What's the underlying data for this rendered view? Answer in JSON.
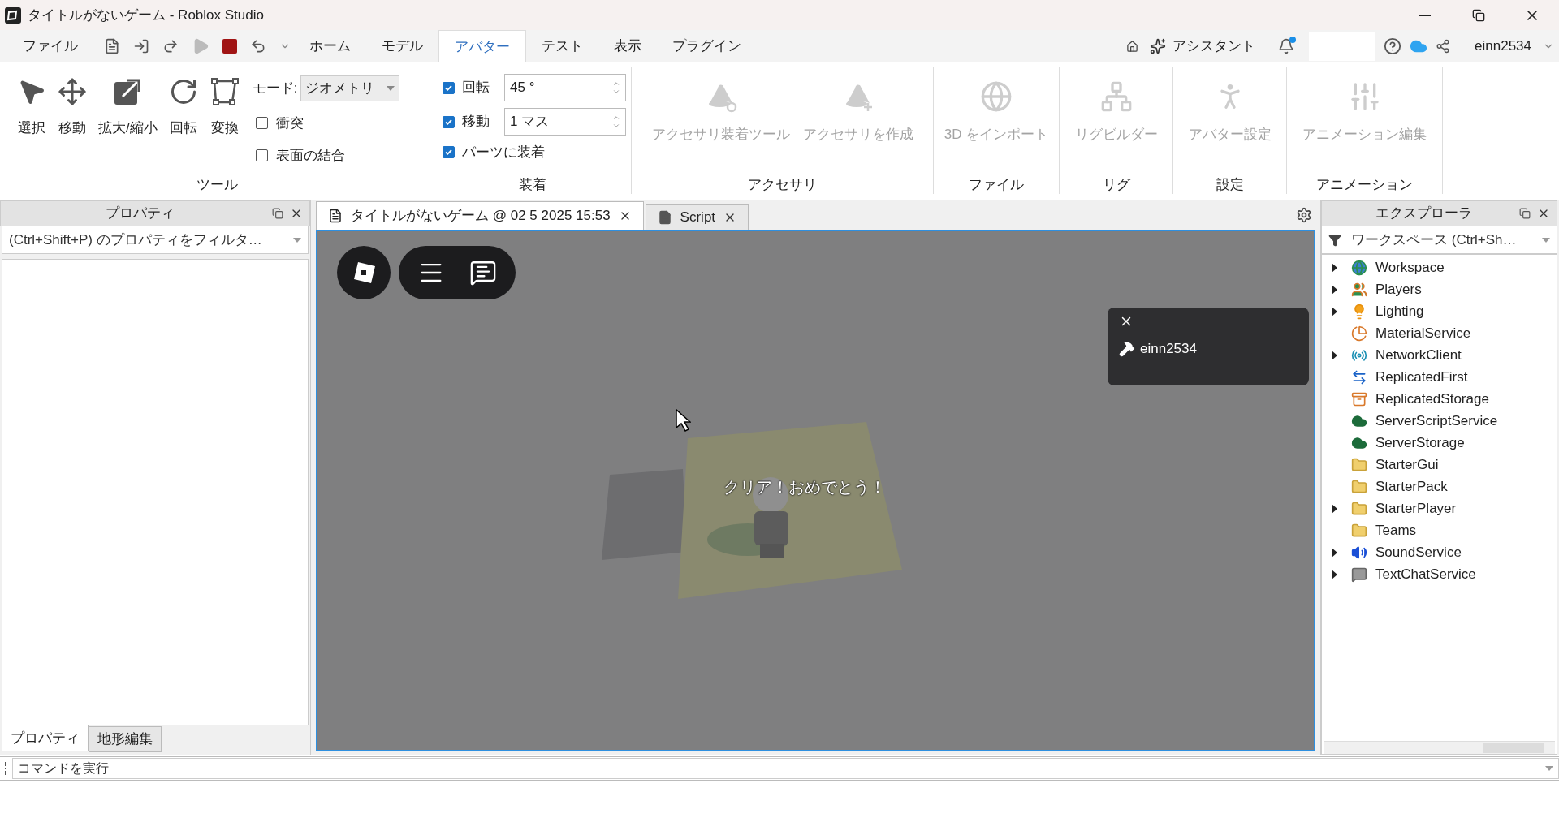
{
  "window": {
    "title": "タイトルがないゲーム - Roblox Studio"
  },
  "menu": {
    "file": "ファイル",
    "tabs": [
      {
        "label": "ホーム",
        "selected": false
      },
      {
        "label": "モデル",
        "selected": false
      },
      {
        "label": "アバター",
        "selected": true
      },
      {
        "label": "テスト",
        "selected": false
      },
      {
        "label": "表示",
        "selected": false
      },
      {
        "label": "プラグイン",
        "selected": false
      }
    ],
    "assistant": "アシスタント",
    "notification_unread": true,
    "user": "einn2534"
  },
  "ribbon": {
    "tools": {
      "label": "ツール",
      "buttons": [
        "選択",
        "移動",
        "拡大/縮小",
        "回転",
        "変換"
      ],
      "mode_label": "モード:",
      "mode_value": "ジオメトリ",
      "options": [
        {
          "label": "衝突",
          "checked": false
        },
        {
          "label": "表面の結合",
          "checked": false
        }
      ]
    },
    "snap": {
      "label": "装着",
      "rows": [
        {
          "label": "回転",
          "checked": true,
          "value": "45 °"
        },
        {
          "label": "移動",
          "checked": true,
          "value": "1 マス"
        }
      ],
      "attach": {
        "label": "パーツに装着",
        "checked": true
      }
    },
    "groups": [
      {
        "label": "アクセサリ",
        "buttons": [
          {
            "label": "アクセサリ装着ツール",
            "disabled": true
          },
          {
            "label": "アクセサリを作成",
            "disabled": true
          }
        ]
      },
      {
        "label": "ファイル",
        "buttons": [
          {
            "label": "3D をインポート",
            "disabled": true
          }
        ]
      },
      {
        "label": "リグ",
        "buttons": [
          {
            "label": "リグビルダー",
            "disabled": true
          }
        ]
      },
      {
        "label": "設定",
        "buttons": [
          {
            "label": "アバター設定",
            "disabled": true
          }
        ]
      },
      {
        "label": "アニメーション",
        "buttons": [
          {
            "label": "アニメーション編集",
            "disabled": true
          }
        ]
      }
    ]
  },
  "properties": {
    "title": "プロパティ",
    "placeholder": "(Ctrl+Shift+P) のプロパティをフィルタ…",
    "tabs": [
      {
        "label": "プロパティ",
        "selected": true
      },
      {
        "label": "地形編集",
        "selected": false
      }
    ]
  },
  "documents": [
    {
      "label": "タイトルがないゲーム @ 02 5 2025 15:53",
      "selected": true
    },
    {
      "label": "Script",
      "selected": false
    }
  ],
  "viewport": {
    "notification_user": "einn2534",
    "message": "クリア！おめでとう！"
  },
  "explorer": {
    "title": "エクスプローラ",
    "placeholder": "ワークスペース (Ctrl+Sh…",
    "items": [
      {
        "name": "Workspace",
        "expandable": true
      },
      {
        "name": "Players",
        "expandable": true
      },
      {
        "name": "Lighting",
        "expandable": true
      },
      {
        "name": "MaterialService",
        "expandable": false
      },
      {
        "name": "NetworkClient",
        "expandable": true
      },
      {
        "name": "ReplicatedFirst",
        "expandable": false
      },
      {
        "name": "ReplicatedStorage",
        "expandable": false
      },
      {
        "name": "ServerScriptService",
        "expandable": false
      },
      {
        "name": "ServerStorage",
        "expandable": false
      },
      {
        "name": "StarterGui",
        "expandable": false
      },
      {
        "name": "StarterPack",
        "expandable": false
      },
      {
        "name": "StarterPlayer",
        "expandable": true
      },
      {
        "name": "Teams",
        "expandable": false
      },
      {
        "name": "SoundService",
        "expandable": true
      },
      {
        "name": "TextChatService",
        "expandable": true
      }
    ]
  },
  "command_bar": {
    "placeholder": "コマンドを実行"
  }
}
